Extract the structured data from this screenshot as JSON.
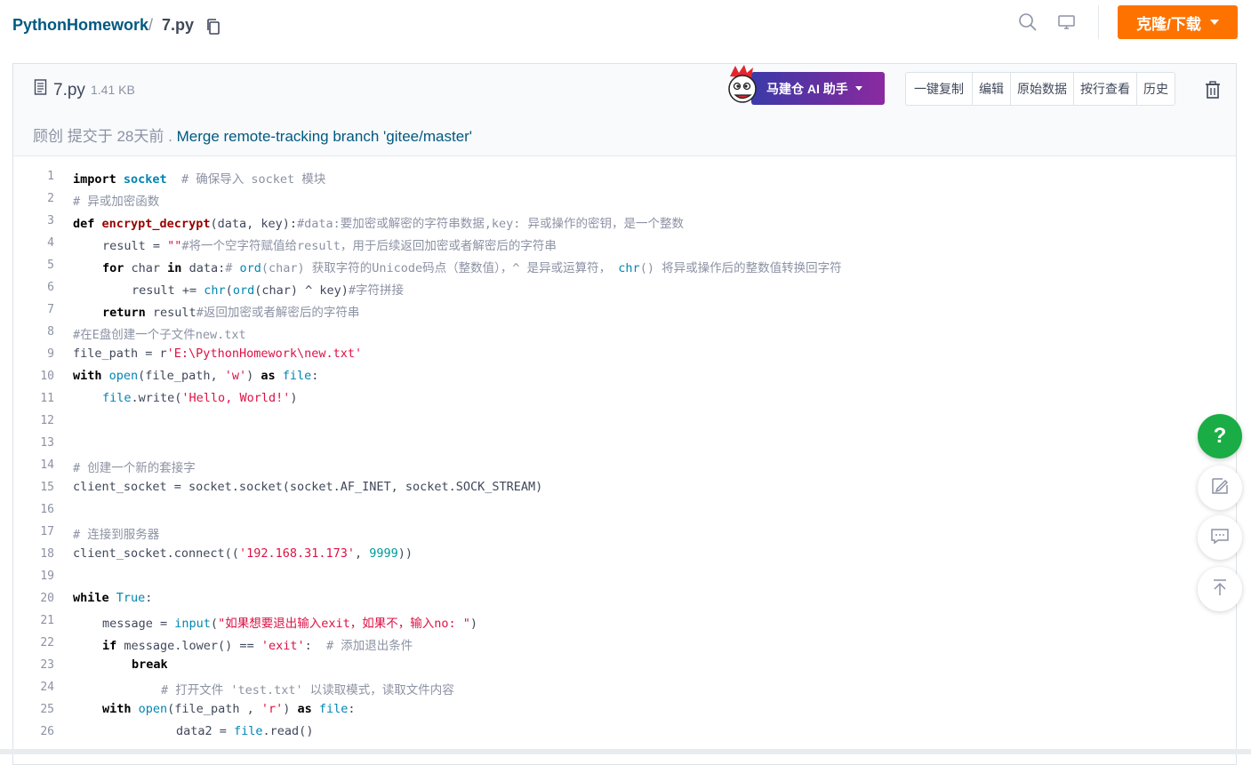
{
  "breadcrumb": {
    "repo": "PythonHomework",
    "separator": "/",
    "file": "7.py"
  },
  "header": {
    "clone_label": "克隆/下载"
  },
  "file": {
    "name": "7.py",
    "size": "1.41 KB",
    "ai_assistant_label": "马建仓 AI 助手",
    "actions": [
      "一键复制",
      "编辑",
      "原始数据",
      "按行查看",
      "历史"
    ],
    "commit": {
      "author": "顾创",
      "action": "提交于",
      "time": "28天前",
      "dot": ".",
      "message": "Merge remote-tracking branch 'gitee/master'"
    }
  },
  "code_lines": [
    {
      "n": "1"
    },
    {
      "n": "2"
    },
    {
      "n": "3"
    },
    {
      "n": "4"
    },
    {
      "n": "5"
    },
    {
      "n": "6"
    },
    {
      "n": "7"
    },
    {
      "n": "8"
    },
    {
      "n": "9"
    },
    {
      "n": "10"
    },
    {
      "n": "11"
    },
    {
      "n": "12"
    },
    {
      "n": "13"
    },
    {
      "n": "14"
    },
    {
      "n": "15"
    },
    {
      "n": "16"
    },
    {
      "n": "17"
    },
    {
      "n": "18"
    },
    {
      "n": "19"
    },
    {
      "n": "20"
    },
    {
      "n": "21"
    },
    {
      "n": "22"
    },
    {
      "n": "23"
    },
    {
      "n": "24"
    },
    {
      "n": "25"
    },
    {
      "n": "26"
    }
  ],
  "code": {
    "l1": {
      "kw": "import",
      "mod": "socket",
      "cm": "# 确保导入 socket 模块"
    },
    "l2": {
      "cm": "# 异或加密函数"
    },
    "l3": {
      "kw": "def",
      "fn": "encrypt_decrypt",
      "args": "(data, key):",
      "cm": "#data:要加密或解密的字符串数据,key: 异或操作的密钥，是一个整数"
    },
    "l4": {
      "a": "result = ",
      "st": "\"\"",
      "cm": "#将一个空字符赋值给result，用于后续返回加密或者解密后的字符串"
    },
    "l5": {
      "kw1": "for",
      "a": " char ",
      "kw2": "in",
      "b": " data:",
      "cm1": "# ",
      "bi1": "ord",
      "cm2": "(char) 获取字符的Unicode码点（整数值），^ 是异或运算符， ",
      "bi2": "chr",
      "cm3": "() 将异或操作后的整数值转换回字符"
    },
    "l6": {
      "a": "result += ",
      "bi1": "chr",
      "b": "(",
      "bi2": "ord",
      "c": "(char) ^ key)",
      "cm": "#字符拼接"
    },
    "l7": {
      "kw": "return",
      "a": " result",
      "cm": "#返回加密或者解密后的字符串"
    },
    "l8": {
      "cm": "#在E盘创建一个子文件new.txt"
    },
    "l9": {
      "a": "file_path = r",
      "st": "'E:\\PythonHomework\\new.txt'"
    },
    "l10": {
      "kw1": "with",
      "bi1": "open",
      "a": "(file_path, ",
      "st": "'w'",
      "b": ") ",
      "kw2": "as",
      "bi2": "file",
      "c": ":"
    },
    "l11": {
      "bi": "file",
      "a": ".write(",
      "st": "'Hello, World!'",
      "b": ")"
    },
    "l14": {
      "cm": "# 创建一个新的套接字"
    },
    "l15": {
      "a": "client_socket = socket.socket(socket.AF_INET, socket.SOCK_STREAM)"
    },
    "l17": {
      "cm": "# 连接到服务器"
    },
    "l18": {
      "a": "client_socket.connect((",
      "st": "'192.168.31.173'",
      "b": ", ",
      "nm": "9999",
      "c": "))"
    },
    "l20": {
      "kw": "while",
      "bi": "True",
      "a": ":"
    },
    "l21": {
      "a": "message = ",
      "bi": "input",
      "b": "(",
      "st": "\"如果想要退出输入exit，如果不，输入no: \"",
      "c": ")"
    },
    "l22": {
      "kw": "if",
      "a": " message.lower() == ",
      "st": "'exit'",
      "b": ":  ",
      "cm": "# 添加退出条件"
    },
    "l23": {
      "kw": "break"
    },
    "l24": {
      "cm": "# 打开文件 'test.txt' 以读取模式，读取文件内容"
    },
    "l25": {
      "kw1": "with",
      "bi1": "open",
      "a": "(file_path , ",
      "st": "'r'",
      "b": ") ",
      "kw2": "as",
      "bi2": "file",
      "c": ":"
    },
    "l26": {
      "a": "data2 = ",
      "bi": "file",
      "b": ".read()"
    }
  },
  "floating": {
    "help_label": "?"
  },
  "colors": {
    "brand_orange": "#fe7300",
    "link_blue": "#005980",
    "help_green": "#1aad45"
  },
  "icons": [
    "copy-icon",
    "search-icon",
    "monitor-icon",
    "file-icon",
    "mascot-icon",
    "trash-icon",
    "feedback-icon",
    "comment-icon",
    "back-to-top-icon"
  ]
}
